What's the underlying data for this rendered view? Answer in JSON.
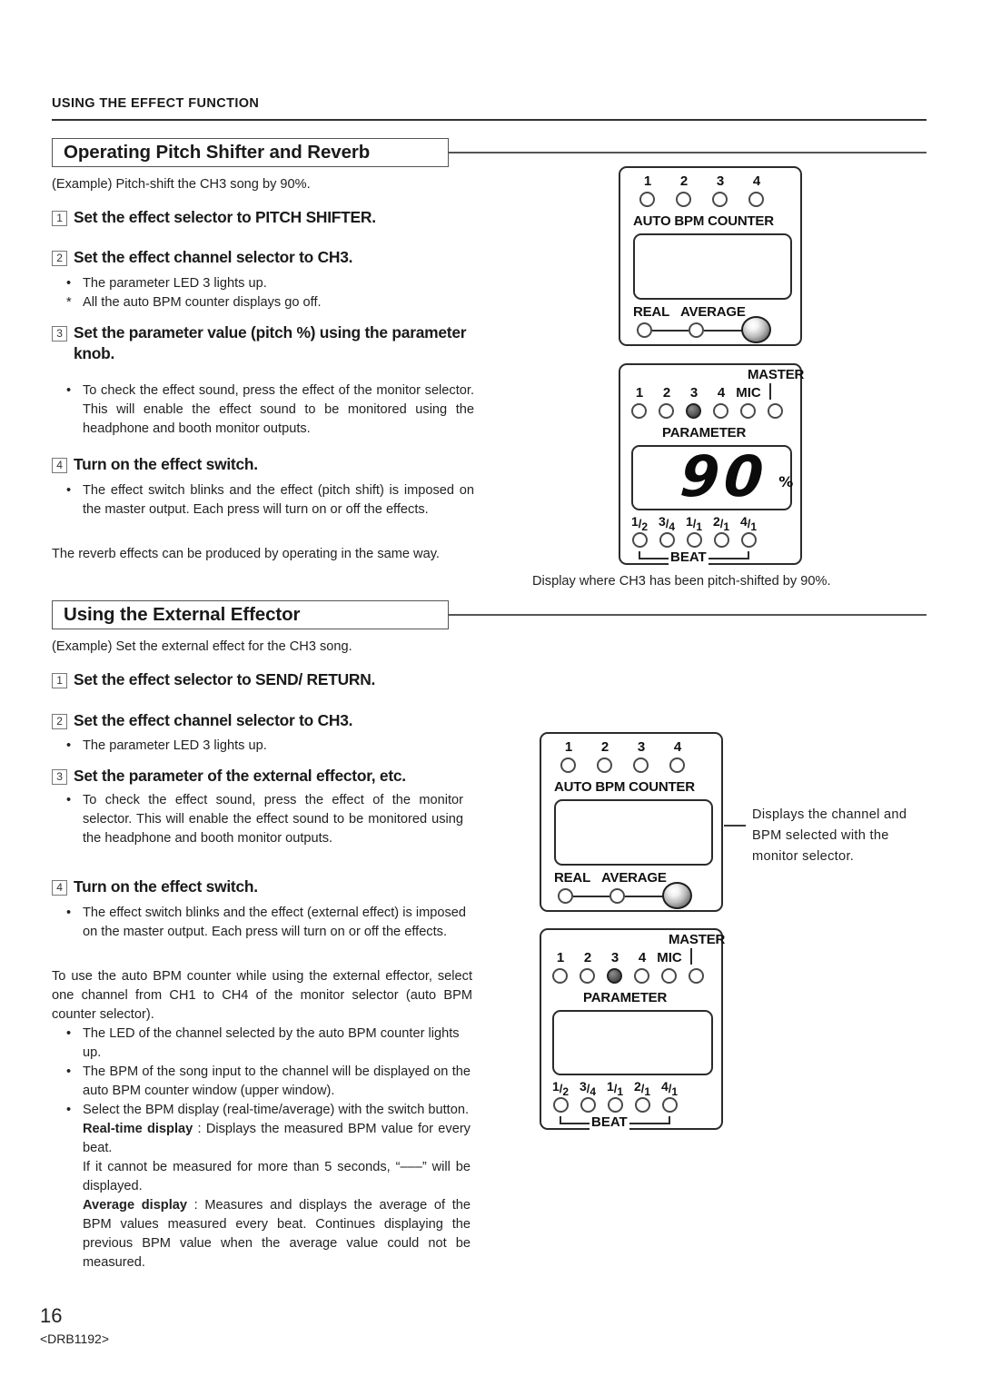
{
  "running_head": "USING THE EFFECT FUNCTION",
  "sections": [
    {
      "heading": "Operating Pitch Shifter and Reverb",
      "example": "(Example) Pitch-shift the CH3 song by 90%.",
      "steps": [
        {
          "num": "1",
          "text": "Set the effect selector to PITCH SHIFTER."
        },
        {
          "num": "2",
          "text": "Set the effect channel selector to CH3."
        },
        {
          "num": "3",
          "text": "Set the parameter value (pitch %) using the parameter knob."
        },
        {
          "num": "4",
          "text": "Turn on the effect switch."
        }
      ],
      "bullets_step2": [
        {
          "mark": "•",
          "text": "The parameter LED 3 lights up."
        },
        {
          "mark": "*",
          "text": "All the auto BPM counter displays go off."
        }
      ],
      "bullets_step3": [
        {
          "mark": "•",
          "text": "To check the effect sound, press the effect of the monitor selector. This will enable the effect sound to be monitored using the headphone and booth monitor outputs."
        }
      ],
      "bullets_step4": [
        {
          "mark": "•",
          "text": "The effect switch blinks and the effect (pitch shift) is imposed on the master output. Each press will turn on or off the effects."
        }
      ],
      "closing": "The reverb effects can be produced by operating in the same way."
    },
    {
      "heading": "Using the External Effector",
      "example": "(Example) Set the external effect for the CH3 song.",
      "steps": [
        {
          "num": "1",
          "text": "Set the effect selector to SEND/ RETURN."
        },
        {
          "num": "2",
          "text": "Set the effect channel selector to CH3."
        },
        {
          "num": "3",
          "text": "Set the parameter of the external effector, etc."
        },
        {
          "num": "4",
          "text": "Turn on the effect switch."
        }
      ],
      "bullets_step2": [
        {
          "mark": "•",
          "text": "The parameter LED 3 lights up."
        }
      ],
      "bullets_step3": [
        {
          "mark": "•",
          "text": "To check the effect sound, press the effect of the monitor selector. This will enable the effect sound to be monitored using the headphone and booth monitor outputs."
        }
      ],
      "bullets_step4": [
        {
          "mark": "•",
          "text": "The effect switch blinks and the effect (external effect) is imposed on the master output. Each press will turn on or off the effects."
        }
      ],
      "closing": "To use the auto BPM counter while using the external effector, select one channel from CH1 to CH4 of the monitor selector (auto BPM counter selector).",
      "tail_bullets": [
        {
          "mark": "•",
          "segments": [
            {
              "text": "The LED of the channel selected by the auto BPM counter lights up."
            }
          ]
        },
        {
          "mark": "•",
          "segments": [
            {
              "text": "The BPM of the song input to the channel will be displayed on the auto BPM counter window (upper window)."
            }
          ]
        },
        {
          "mark": "•",
          "segments": [
            {
              "text": "Select the BPM display (real-time/average) with the switch button."
            },
            {
              "bold": "Real-time display",
              "text": " : Displays the measured BPM value for every beat."
            },
            {
              "text": "If it cannot be measured for more than 5 seconds, “–––” will be displayed."
            },
            {
              "bold": "Average display",
              "text": " : Measures and displays the average of the BPM values measured every beat. Continues displaying the previous BPM value when the average value could not be measured."
            }
          ]
        }
      ]
    }
  ],
  "diagrams": {
    "bpm_counter": {
      "led_labels": [
        "1",
        "2",
        "3",
        "4"
      ],
      "title": "AUTO BPM COUNTER",
      "switch_labels": [
        "REAL",
        "AVERAGE"
      ],
      "window_value": ""
    },
    "parameter_top": {
      "led_labels": [
        "1",
        "2",
        "3",
        "4",
        "MIC"
      ],
      "master_label": "MASTER",
      "lit_index": 2,
      "title": "PARAMETER",
      "display_value": "90",
      "display_unit": "%",
      "beat_labels": [
        {
          "num": "1",
          "den": "2"
        },
        {
          "num": "3",
          "den": "4"
        },
        {
          "num": "1",
          "den": "1"
        },
        {
          "num": "2",
          "den": "1"
        },
        {
          "num": "4",
          "den": "1"
        }
      ],
      "beat_word": "BEAT"
    },
    "parameter_bottom": {
      "led_labels": [
        "1",
        "2",
        "3",
        "4",
        "MIC"
      ],
      "master_label": "MASTER",
      "lit_index": 2,
      "title": "PARAMETER",
      "display_value": "",
      "display_unit": "",
      "beat_labels": [
        {
          "num": "1",
          "den": "2"
        },
        {
          "num": "3",
          "den": "4"
        },
        {
          "num": "1",
          "den": "1"
        },
        {
          "num": "2",
          "den": "1"
        },
        {
          "num": "4",
          "den": "1"
        }
      ],
      "beat_word": "BEAT"
    },
    "caption_top": "Display where CH3 has been pitch-shifted by 90%.",
    "callout_bottom": "Displays the channel and BPM selected with the monitor selector."
  },
  "footer": {
    "page_number": "16",
    "doc_code": "<DRB1192>"
  }
}
